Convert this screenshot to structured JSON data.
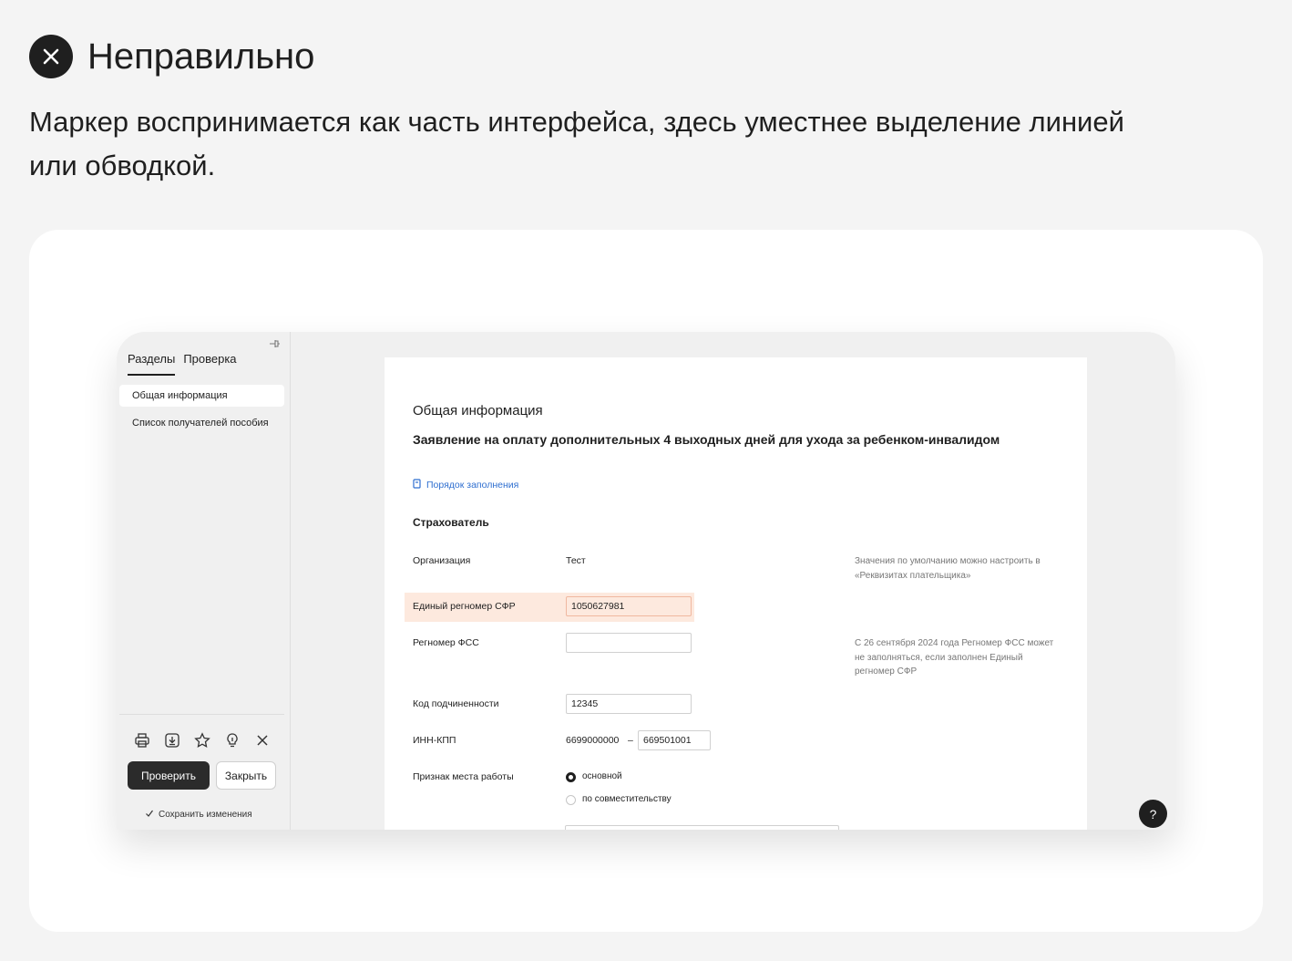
{
  "header": {
    "icon": "close-icon",
    "title": "Неправильно",
    "description": "Маркер воспринимается как часть интерфейса, здесь уместнее выделение линией или обводкой."
  },
  "sidebar": {
    "pin_icon": "pin-icon",
    "tabs": [
      {
        "label": "Разделы",
        "active": true
      },
      {
        "label": "Проверка",
        "active": false
      }
    ],
    "items": [
      {
        "label": "Общая информация",
        "active": true
      },
      {
        "label": "Список получателей пособия",
        "active": false
      }
    ],
    "tools": [
      "print-icon",
      "download-icon",
      "star-icon",
      "lightbulb-icon",
      "close-icon"
    ],
    "check_button": "Проверить",
    "close_button": "Закрыть",
    "save_note": "Сохранить изменения"
  },
  "document": {
    "section": "Общая информация",
    "title": "Заявление на оплату дополнительных 4 выходных дней для ухода за ребенком-инвалидом",
    "link": "Порядок заполнения",
    "subtitle": "Страхователь",
    "fields": {
      "org_label": "Организация",
      "org_value": "Тест",
      "org_hint": "Значения по умолчанию можно настроить в «Реквизитах плательщика»",
      "sfr_label": "Единый регномер СФР",
      "sfr_value": "1050627981",
      "fss_label": "Регномер ФСС",
      "fss_value": "",
      "fss_hint": "С 26 сентября 2024 года Регномер ФСС может не заполняться, если заполнен Единый регномер СФР",
      "code_label": "Код подчиненности",
      "code_value": "12345",
      "inn_label": "ИНН-КПП",
      "inn_value": "6699000000",
      "inn_sep": "–",
      "kpp_value": "669501001",
      "work_label": "Признак места работы",
      "work_options": [
        "основной",
        "по совместительству"
      ],
      "work_selected": "основной"
    }
  },
  "help_label": "?",
  "colors": {
    "highlight": "#fde9de",
    "link": "#2f6fd0",
    "dark": "#1f1f1f"
  }
}
